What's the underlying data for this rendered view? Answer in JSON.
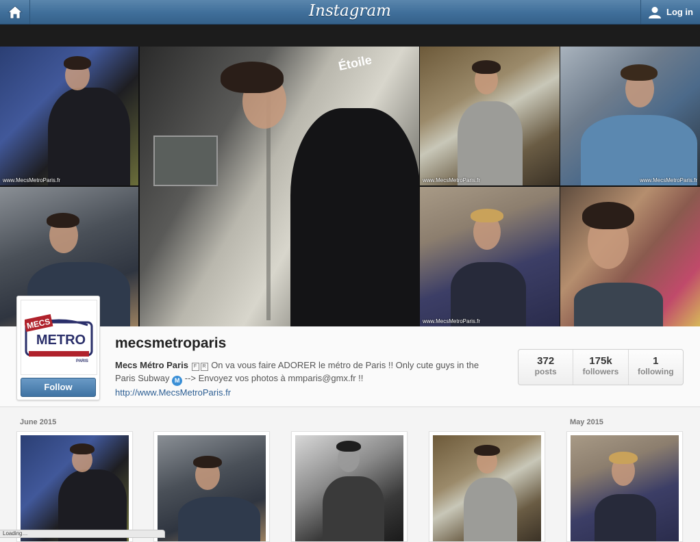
{
  "header": {
    "brand": "Instagram",
    "login_label": "Log in",
    "home_icon": "home-icon",
    "user_icon": "user-icon"
  },
  "cover": {
    "watermark": "www.MecsMetroParis.fr",
    "sign_text": "Étoile"
  },
  "profile": {
    "username": "mecsmetroparis",
    "display_name": "Mecs Métro Paris",
    "bio_flag1": "F",
    "bio_flag2": "R",
    "bio_text1": "On va vous faire ADORER le métro de Paris !! Only cute guys in the Paris Subway",
    "metro_badge": "M",
    "bio_text2": "--> Envoyez vos photos à mmparis@gmx.fr !!",
    "website": "http://www.MecsMetroParis.fr",
    "follow_label": "Follow",
    "avatar": {
      "line1": "MECS",
      "line2": "METRO",
      "line3": "PARIS"
    }
  },
  "stats": [
    {
      "value": "372",
      "label": "posts"
    },
    {
      "value": "175k",
      "label": "followers"
    },
    {
      "value": "1",
      "label": "following"
    }
  ],
  "grid": {
    "month_left": "June 2015",
    "month_right": "May 2015"
  },
  "statusbar": {
    "text": "Loading…"
  },
  "colors": {
    "topbar": "#3f6e99",
    "follow_button": "#4a7eb0",
    "link": "#2c5e93",
    "metro_badge": "#3a8fd6"
  }
}
